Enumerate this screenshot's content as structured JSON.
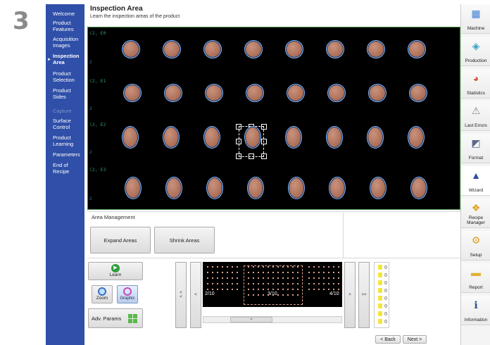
{
  "step_number": "3",
  "nav": {
    "items": [
      {
        "label": "Welcome",
        "state": "normal"
      },
      {
        "label": "Product Features",
        "state": "normal"
      },
      {
        "label": "Acquisition Images",
        "state": "normal"
      },
      {
        "label": "Inspection Area",
        "state": "active"
      },
      {
        "label": "Product Selection",
        "state": "normal"
      },
      {
        "label": "Product Sides",
        "state": "normal"
      },
      {
        "label": "Capture",
        "state": "dim"
      },
      {
        "label": "Surface Control",
        "state": "normal"
      },
      {
        "label": "Product Learning",
        "state": "normal"
      },
      {
        "label": "Parameters",
        "state": "normal"
      },
      {
        "label": "End of Recipe",
        "state": "normal"
      }
    ]
  },
  "header": {
    "title": "Inspection Area",
    "subtitle": "Learn the inspection areas of the product"
  },
  "image": {
    "row_labels": [
      "(2, E0",
      "(2, E1",
      "(2, E2",
      "(2, E3"
    ],
    "side_numbers": [
      "2",
      "2",
      "2",
      "2"
    ],
    "tablets_per_row": [
      8,
      8,
      8,
      8
    ]
  },
  "area_management": {
    "title": "Area Management",
    "expand_label": "Expand Areas",
    "shrink_label": "Shrink Areas"
  },
  "tools": {
    "learn_label": "Learn",
    "zoom_label": "Zoom",
    "graphic_label": "Graphic",
    "adv_params_label": "Adv. Params"
  },
  "thumbs": {
    "labels": [
      "2/10",
      "3/10",
      "4/10"
    ],
    "first_label": "<\n<",
    "prev_label": "<",
    "next_label": ">",
    "last_label": ">>",
    "scroll_label": "="
  },
  "footer": {
    "back_label": "< Back",
    "next_label": "Next >"
  },
  "toolbar": {
    "items": [
      {
        "label": "Machine",
        "icon": "machine-icon",
        "glyph": "▦"
      },
      {
        "label": "Production",
        "icon": "production-icon",
        "glyph": "◈"
      },
      {
        "label": "Statistics",
        "icon": "statistics-icon",
        "glyph": "◕"
      },
      {
        "label": "Last Errors",
        "icon": "last-errors-icon",
        "glyph": "⚠"
      },
      {
        "label": "Format",
        "icon": "format-icon",
        "glyph": "◩"
      },
      {
        "label": "Wizard",
        "icon": "wizard-icon",
        "glyph": "▲"
      },
      {
        "label": "Recipe Manager",
        "icon": "recipe-manager-icon",
        "glyph": "❖"
      },
      {
        "label": "Setup",
        "icon": "setup-icon",
        "glyph": "⚙"
      },
      {
        "label": "Report",
        "icon": "report-icon",
        "glyph": "▬"
      },
      {
        "label": "Information",
        "icon": "information-icon",
        "glyph": "ℹ"
      }
    ]
  },
  "colors": {
    "nav_bg": "#2f4fa8",
    "image_bg": "#000000",
    "tablet": "#b0735c",
    "accent_blue": "#7fb7ff"
  }
}
